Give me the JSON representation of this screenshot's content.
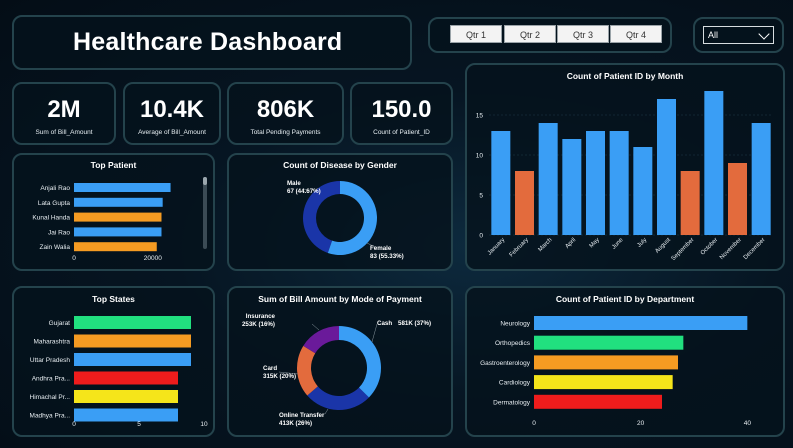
{
  "header": {
    "title": "Healthcare Dashboard"
  },
  "quarter_filter": [
    "Qtr 1",
    "Qtr 2",
    "Qtr 3",
    "Qtr 4"
  ],
  "dropdown": {
    "selected": "All"
  },
  "kpis": [
    {
      "value": "2M",
      "label": "Sum of Bill_Amount"
    },
    {
      "value": "10.4K",
      "label": "Average of Bill_Amount"
    },
    {
      "value": "806K",
      "label": "Total Pending Payments"
    },
    {
      "value": "150.0",
      "label": "Count of Patient_ID"
    }
  ],
  "colors": {
    "blue": "#3a9ef5",
    "orange": "#e36b3d",
    "amber": "#f59b22",
    "green": "#21e07f",
    "yellow": "#f5e51a",
    "red": "#ef1c1c",
    "navy": "#1a35a8",
    "purple": "#6a1a9a"
  },
  "chart_data": [
    {
      "id": "top_patient",
      "type": "bar",
      "orientation": "horizontal",
      "title": "Top Patient",
      "categories": [
        "Anjali Rao",
        "Lata Gupta",
        "Kunal Handa",
        "Jai Rao",
        "Zain Walia"
      ],
      "values": [
        24500,
        22500,
        22200,
        22200,
        21000
      ],
      "colors": [
        "#3a9ef5",
        "#3a9ef5",
        "#f59b22",
        "#3a9ef5",
        "#f59b22"
      ],
      "xticks": [
        "0",
        "20000"
      ],
      "xlim": [
        0,
        34000
      ]
    },
    {
      "id": "disease_by_gender",
      "type": "pie",
      "donut": true,
      "title": "Count of Disease by Gender",
      "slices": [
        {
          "name": "Male",
          "label": "67 (44.67%)",
          "value": 67,
          "color": "#1a35a8"
        },
        {
          "name": "Female",
          "label": "83 (55.33%)",
          "value": 83,
          "color": "#3a9ef5"
        }
      ]
    },
    {
      "id": "patients_by_month",
      "type": "bar",
      "title": "Count of Patient ID by Month",
      "categories": [
        "January",
        "February",
        "March",
        "April",
        "May",
        "June",
        "July",
        "August",
        "September",
        "October",
        "November",
        "December"
      ],
      "values": [
        13,
        8,
        14,
        12,
        13,
        13,
        11,
        17,
        8,
        18,
        9,
        14
      ],
      "colors": [
        "#3a9ef5",
        "#e36b3d",
        "#3a9ef5",
        "#3a9ef5",
        "#3a9ef5",
        "#3a9ef5",
        "#3a9ef5",
        "#3a9ef5",
        "#e36b3d",
        "#3a9ef5",
        "#e36b3d",
        "#3a9ef5"
      ],
      "yticks": [
        "0",
        "5",
        "10",
        "15"
      ],
      "ylim": [
        0,
        19
      ]
    },
    {
      "id": "top_states",
      "type": "bar",
      "orientation": "horizontal",
      "title": "Top States",
      "categories": [
        "Gujarat",
        "Maharashtra",
        "Uttar Pradesh",
        "Andhra Pra...",
        "Himachal Pr...",
        "Madhya Pra..."
      ],
      "values": [
        9,
        9,
        9,
        8,
        8,
        8
      ],
      "colors": [
        "#21e07f",
        "#f59b22",
        "#3a9ef5",
        "#ef1c1c",
        "#f5e51a",
        "#3a9ef5"
      ],
      "xticks": [
        "0",
        "5",
        "10"
      ],
      "xlim": [
        0,
        10
      ]
    },
    {
      "id": "bill_by_payment",
      "type": "pie",
      "donut": true,
      "title": "Sum of Bill Amount by Mode of Payment",
      "slices": [
        {
          "name": "Cash",
          "label": "581K (37%)",
          "value": 37,
          "color": "#3a9ef5"
        },
        {
          "name": "Online Transfer",
          "label": "413K (26%)",
          "value": 26,
          "color": "#1a35a8"
        },
        {
          "name": "Card",
          "label": "315K (20%)",
          "value": 20,
          "color": "#e36b3d"
        },
        {
          "name": "Insurance",
          "label": "253K (16%)",
          "value": 16,
          "color": "#6a1a9a"
        }
      ]
    },
    {
      "id": "patients_by_department",
      "type": "bar",
      "orientation": "horizontal",
      "title": "Count of Patient ID by Department",
      "categories": [
        "Neurology",
        "Orthopedics",
        "Gastroenterology",
        "Cardiology",
        "Dermatology"
      ],
      "values": [
        40,
        28,
        27,
        26,
        24
      ],
      "colors": [
        "#3a9ef5",
        "#21e07f",
        "#f59b22",
        "#f5e51a",
        "#ef1c1c"
      ],
      "xticks": [
        "0",
        "20",
        "40"
      ],
      "xlim": [
        0,
        45
      ]
    }
  ]
}
